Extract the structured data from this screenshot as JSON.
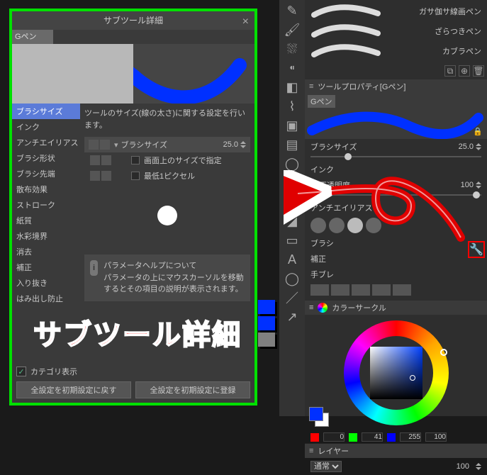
{
  "dialog": {
    "title": "サブツール詳細",
    "tool_name": "Gペン",
    "categories": [
      "ブラシサイズ",
      "インク",
      "アンチエイリアス",
      "ブラシ形状",
      "ブラシ先端",
      "散布効果",
      "ストローク",
      "紙質",
      "水彩境界",
      "消去",
      "補正",
      "入り抜き",
      "はみ出し防止"
    ],
    "selected_category": 0,
    "description": "ツールのサイズ(線の太さ)に関する設定を行います。",
    "param_label": "ブラシサイズ",
    "param_value": "25.0",
    "toggle1": "画面上のサイズで指定",
    "toggle2": "最低1ピクセル",
    "help_title": "パラメータヘルプについて",
    "help_body": "パラメータの上にマウスカーソルを移動するとその項目の説明が表示されます。",
    "category_show": "カテゴリ表示",
    "btn_reset": "全設定を初期設定に戻す",
    "btn_register": "全設定を初期設定に登録",
    "big_label": "サブツール詳細"
  },
  "right": {
    "brushes": [
      {
        "name": "ガサ伽サ線画ペン"
      },
      {
        "name": "ざらつきペン"
      },
      {
        "name": "カブラペン"
      }
    ],
    "tool_property_title": "ツールプロパティ[Gペン]",
    "tool_name": "Gペン",
    "props": {
      "brush_size_label": "ブラシサイズ",
      "brush_size_value": "25.0",
      "ink_label": "インク",
      "opacity_label": "不透明度",
      "opacity_value": "100",
      "aa_label": "アンチエイリアス",
      "brush_shape_label": "ブラシ",
      "correction_label": "補正",
      "stabilize_label": "手ブレ"
    },
    "color_title": "カラーサークル",
    "rgb": {
      "r": "0",
      "g": "41",
      "b": "255",
      "last": "100"
    },
    "layer_title": "レイヤー",
    "layer_mode": "通常",
    "layer_opacity": "100"
  }
}
